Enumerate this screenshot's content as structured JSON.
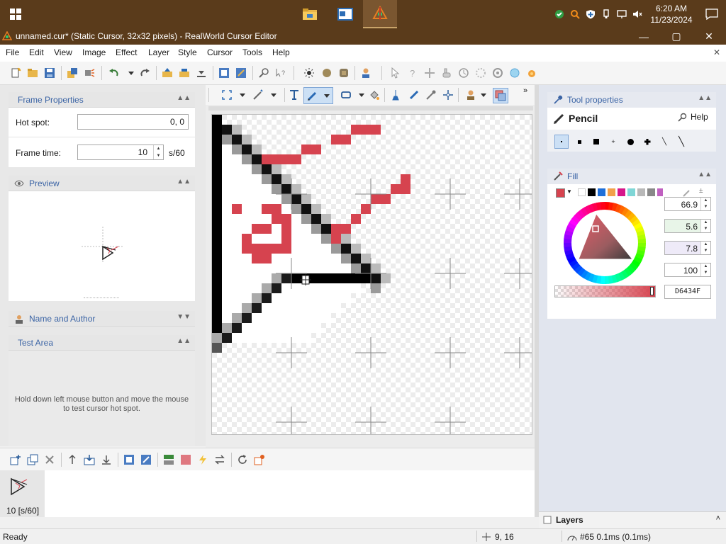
{
  "taskbar": {
    "clock_time": "6:20 AM",
    "clock_date": "11/23/2024"
  },
  "window": {
    "title": "unnamed.cur* (Static Cursor, 32x32 pixels) - RealWorld Cursor Editor",
    "minimize": "—",
    "maximize": "▢",
    "close": "✕"
  },
  "menu": {
    "items": [
      "File",
      "Edit",
      "View",
      "Image",
      "Effect",
      "Layer",
      "Style",
      "Cursor",
      "Tools",
      "Help"
    ],
    "close_glyph": "✕"
  },
  "frame_properties": {
    "title": "Frame Properties",
    "hot_spot_label": "Hot spot:",
    "hot_spot_value": "0, 0",
    "frame_time_label": "Frame time:",
    "frame_time_value": "10",
    "frame_time_unit": "s/60"
  },
  "preview": {
    "title": "Preview"
  },
  "name_author": {
    "title": "Name and Author"
  },
  "test_area": {
    "title": "Test Area",
    "hint": "Hold down left mouse button and move the mouse to test cursor hot spot."
  },
  "tool_properties": {
    "title": "Tool properties",
    "tool_name": "Pencil",
    "help_label": "Help"
  },
  "fill": {
    "title": "Fill",
    "value1": "66.9",
    "value2": "5.6",
    "value3": "7.8",
    "value4": "100",
    "hex": "D6434F",
    "color": "#d6434f"
  },
  "frames": {
    "frame_label": "10 [s/60]"
  },
  "layers": {
    "title": "Layers"
  },
  "status": {
    "ready": "Ready",
    "position": "9, 16",
    "info": "#65 0.1ms (0.1ms)"
  }
}
